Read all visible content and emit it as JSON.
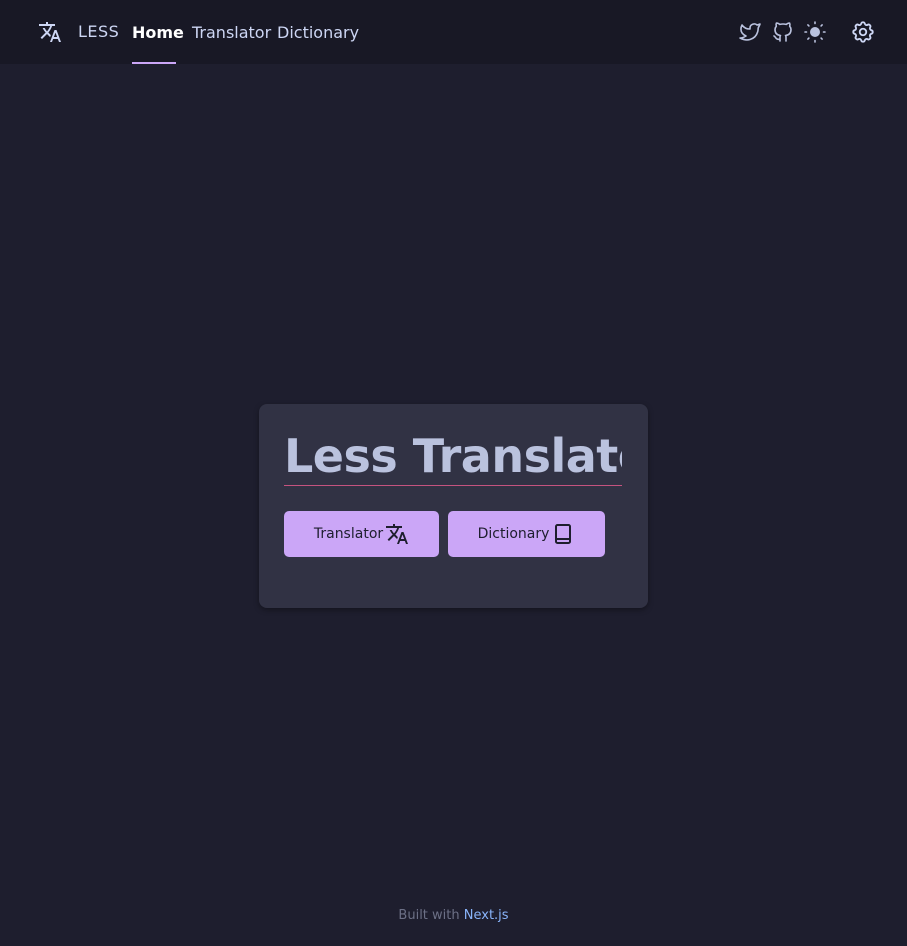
{
  "nav": {
    "brand": "LESS",
    "links": [
      {
        "label": "Home",
        "active": true
      },
      {
        "label": "Translator"
      },
      {
        "label": "Dictionary"
      }
    ],
    "icons": [
      "translate-icon",
      "twitter-icon",
      "github-icon",
      "sun-icon",
      "gear-icon"
    ]
  },
  "hero": {
    "title": "Less Translator",
    "buttons": [
      {
        "label": "Translator",
        "icon": "translate-icon"
      },
      {
        "label": "Dictionary",
        "icon": "book-icon"
      }
    ]
  },
  "footer": {
    "prefix": "Built with",
    "link": "Next.js"
  },
  "colors": {
    "background": "#1e1e2e",
    "navbar": "#181825",
    "card": "#313244",
    "accent": "#cba6f7",
    "divider": "#c5537f",
    "link": "#89b4fa"
  }
}
